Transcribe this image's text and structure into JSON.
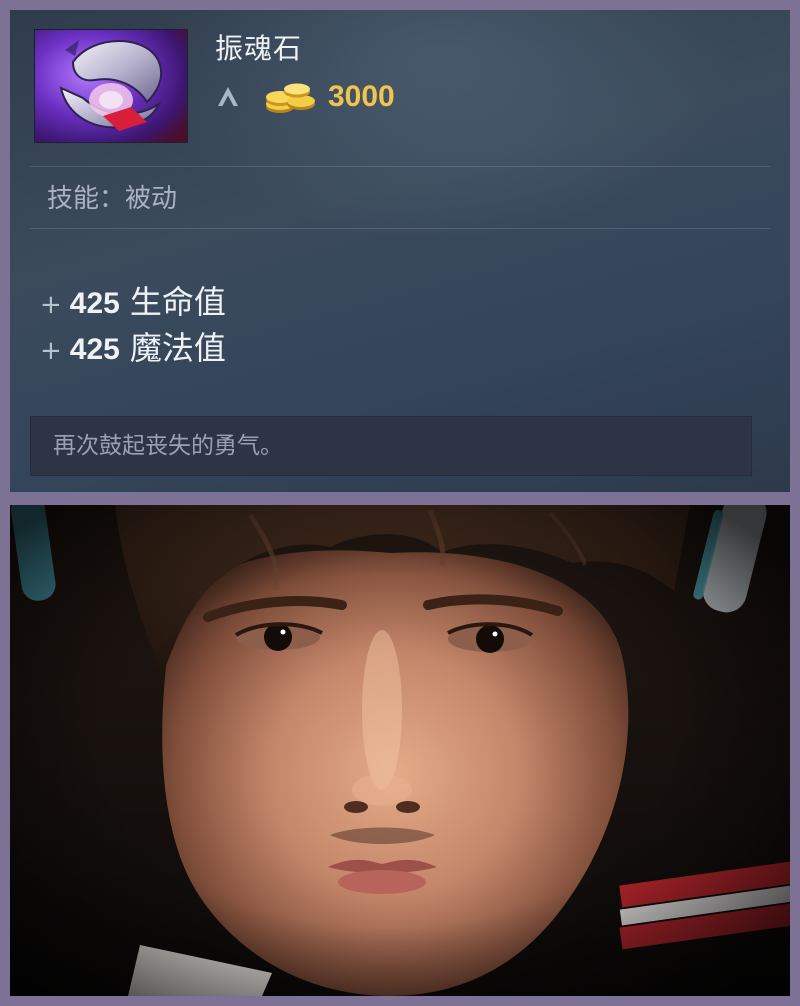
{
  "item": {
    "name": "振魂石",
    "cost": "3000",
    "icon": "soul-booster-item-icon",
    "upgrade_icon": "upgrade-arrow-icon",
    "gold_icon": "gold-coins-icon"
  },
  "ability": "技能：被动",
  "stats": [
    {
      "sign": "+",
      "value": "425",
      "label": "生命值"
    },
    {
      "sign": "+",
      "value": "425",
      "label": "魔法值"
    }
  ],
  "lore": "再次鼓起丧失的勇气。",
  "colors": {
    "frame": "#7e7196",
    "panel": "#334354",
    "gold": "#f2c44d",
    "lore_bg": "#2c3446"
  }
}
